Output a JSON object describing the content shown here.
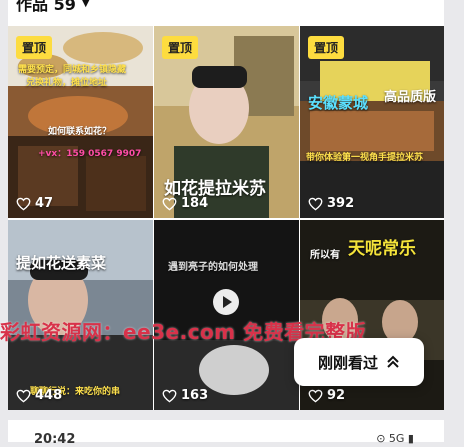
{
  "header": {
    "title": "作品 59"
  },
  "tiles": [
    {
      "pinned": true,
      "pin_label": "置顶",
      "likes": "47",
      "overlay": [
        "需要预定，同城和乡镇隐藏",
        "兑换礼物，摊位地址",
        "如何联系如花？",
        "+vx：159 0567 9907"
      ]
    },
    {
      "pinned": true,
      "pin_label": "置顶",
      "likes": "184",
      "overlay": [
        "如花提拉米苏"
      ]
    },
    {
      "pinned": true,
      "pin_label": "置顶",
      "likes": "392",
      "overlay": [
        "安徽蒙城",
        "高品质版",
        "带你体验第一视角手提拉米苏"
      ]
    },
    {
      "pinned": false,
      "likes": "448",
      "overlay": [
        "提如花送素菜",
        "聊聊行说：来吃你的串"
      ]
    },
    {
      "pinned": false,
      "likes": "163",
      "overlay": [
        "遇到亮子的如何处理"
      ]
    },
    {
      "pinned": false,
      "likes": "92",
      "overlay": [
        "所以有",
        "天呢常乐"
      ]
    }
  ],
  "watermark": "彩虹资源网：ee3e.com 免费看完整版",
  "recent_button": {
    "label": "刚刚看过"
  },
  "status": {
    "time": "20:42",
    "right": "⊙ 5G ▮"
  },
  "icons": {
    "heart": "heart-outline-icon",
    "play": "play-icon",
    "chevron": "double-chevron-up-icon"
  }
}
